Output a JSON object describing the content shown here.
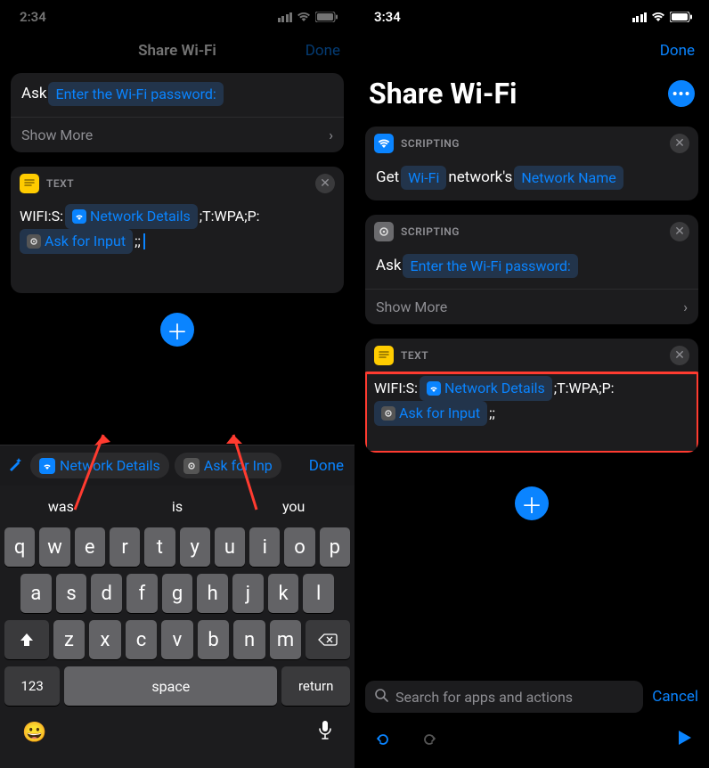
{
  "left": {
    "status": {
      "time": "2:34"
    },
    "header": {
      "title": "Share Wi-Fi",
      "done": "Done"
    },
    "askRow": {
      "ask": "Ask",
      "prompt": "Enter the Wi-Fi password:"
    },
    "showMore": "Show More",
    "textCard": {
      "label": "TEXT",
      "prefix": "WIFI:S:",
      "token1": "Network Details",
      "mid": ";T:WPA;P:",
      "token2": "Ask for Input",
      "suffix": ";;"
    },
    "varBar": {
      "pill1": "Network Details",
      "pill2": "Ask for Inp",
      "done": "Done"
    },
    "sugg": {
      "a": "was",
      "b": "is",
      "c": "you"
    },
    "kb": {
      "r1": [
        "q",
        "w",
        "e",
        "r",
        "t",
        "y",
        "u",
        "i",
        "o",
        "p"
      ],
      "r2": [
        "a",
        "s",
        "d",
        "f",
        "g",
        "h",
        "j",
        "k",
        "l"
      ],
      "r3": [
        "z",
        "x",
        "c",
        "v",
        "b",
        "n",
        "m"
      ],
      "num": "123",
      "space": "space",
      "ret": "return"
    }
  },
  "right": {
    "status": {
      "time": "3:34"
    },
    "done": "Done",
    "title": "Share Wi-Fi",
    "card1": {
      "label": "SCRIPTING",
      "get": "Get",
      "tok1": "Wi-Fi",
      "mid": "network's",
      "tok2": "Network Name"
    },
    "card2": {
      "label": "SCRIPTING",
      "ask": "Ask",
      "prompt": "Enter the Wi-Fi password:",
      "showMore": "Show More"
    },
    "card3": {
      "label": "TEXT",
      "prefix": "WIFI:S:",
      "token1": "Network Details",
      "mid": ";T:WPA;P:",
      "token2": "Ask for Input",
      "suffix": ";;"
    },
    "search": {
      "placeholder": "Search for apps and actions",
      "cancel": "Cancel"
    }
  }
}
